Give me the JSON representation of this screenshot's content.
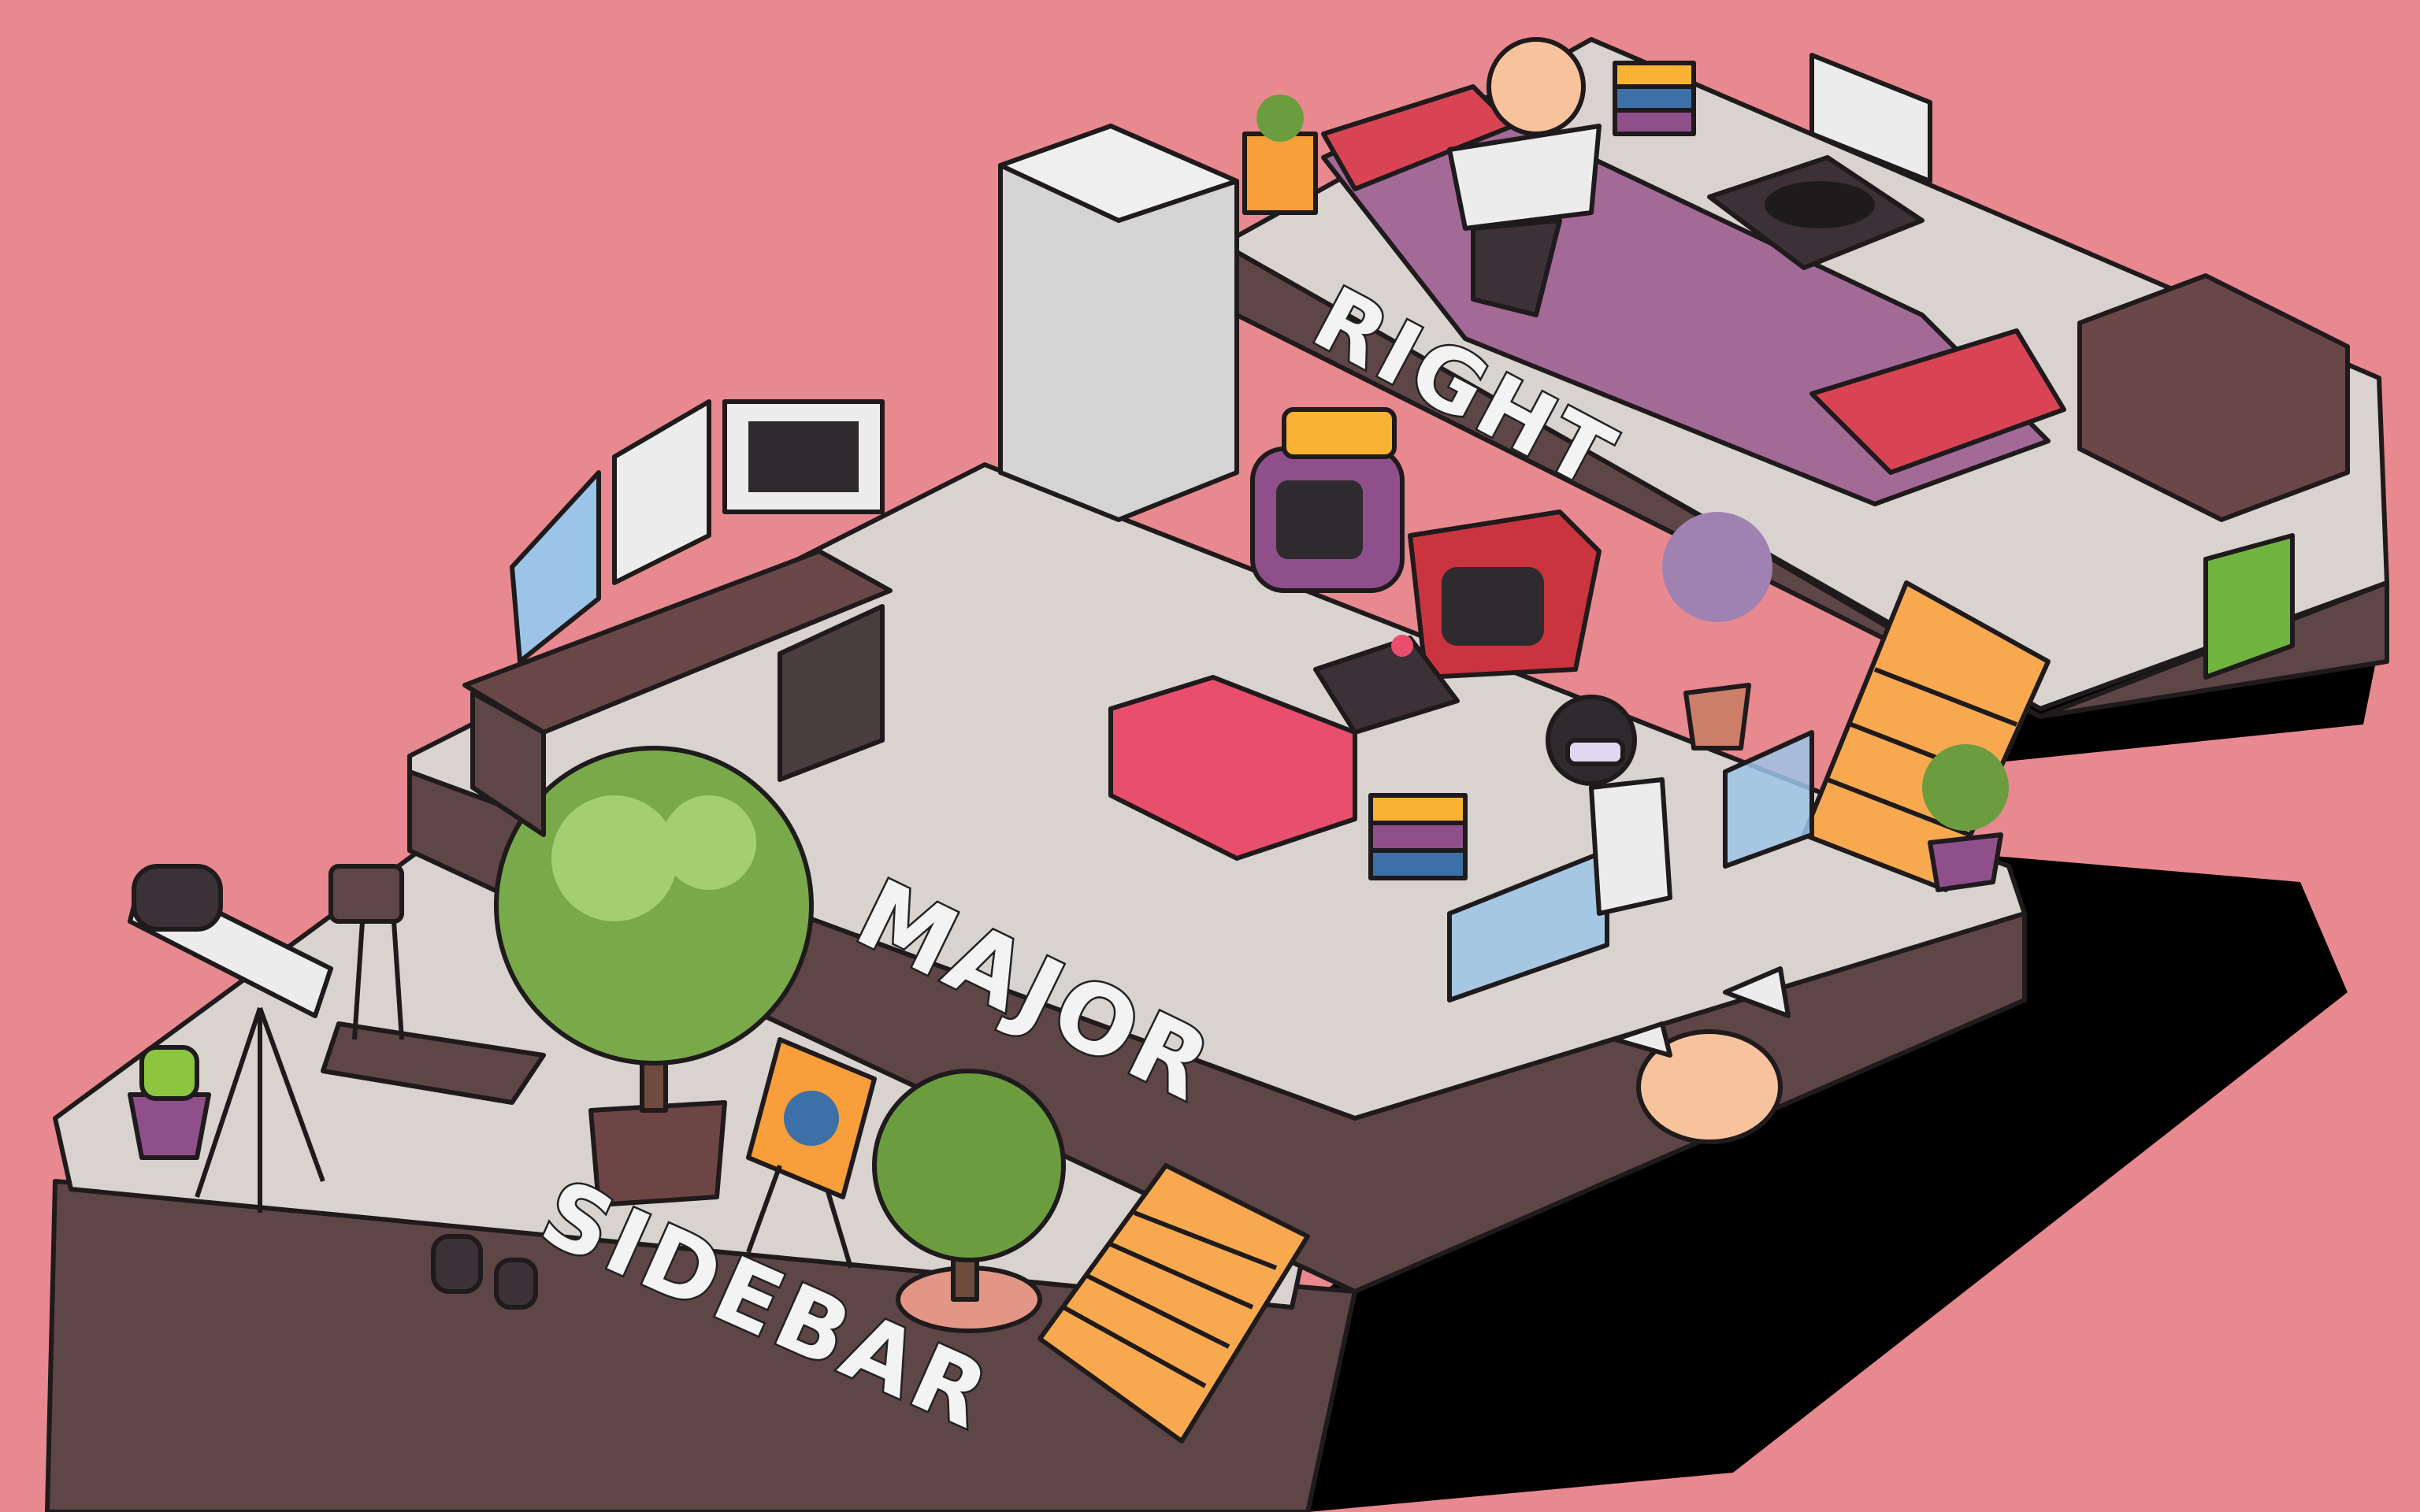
{
  "labels": {
    "sidebar": "SIDEBAR",
    "major": "MAJOR",
    "right": "RIGHT"
  },
  "colors": {
    "background": "#e8898f",
    "platform_top": "#d9d3cf",
    "platform_side": "#5e4646",
    "shadow": "#000000",
    "stairs": "#f8a94f"
  },
  "icons": [
    "telescope-icon",
    "treadmill-icon",
    "tree-icon",
    "easel-icon",
    "bonsai-icon",
    "dumbbell-icon",
    "cactus-icon",
    "desk-icon",
    "monitor-icon",
    "office-chair-icon",
    "refrigerator-icon",
    "robot-tv-icon",
    "retro-tv-icon",
    "arcade-joystick-icon",
    "armchair-icon",
    "book-stack-icon",
    "vr-girl-icon",
    "hologram-screen-icon",
    "flower-vase-icon",
    "staircase-icon",
    "bed-icon",
    "man-on-bed-icon",
    "record-player-icon",
    "dresser-icon",
    "moose-head-icon",
    "potted-plant-icon",
    "green-bag-icon"
  ]
}
